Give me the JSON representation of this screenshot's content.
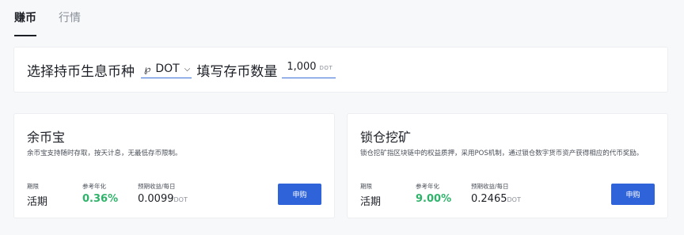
{
  "tabs": [
    {
      "label": "赚币",
      "active": true
    },
    {
      "label": "行情",
      "active": false
    }
  ],
  "selector": {
    "prefix": "选择持币生息币种",
    "coin": "DOT",
    "coin_icon": "polkadot-logo-icon",
    "middle": "填写存币数量",
    "amount": "1,000",
    "amount_unit": "DOT"
  },
  "cards": [
    {
      "title": "余币宝",
      "desc": "余币宝支持随时存取，按天计息，无最低存币限制。",
      "term_label": "期限",
      "term_value": "活期",
      "rate_label": "参考年化",
      "rate_value": "0.36%",
      "income_label": "预期收益/每日",
      "income_value": "0.0099",
      "income_unit": "DOT",
      "button": "申购"
    },
    {
      "title": "锁仓挖矿",
      "desc": "锁仓挖矿指区块链中的权益质押，采用POS机制，通过锁仓数字货币资产获得相应的代币奖励。",
      "term_label": "期限",
      "term_value": "活期",
      "rate_label": "参考年化",
      "rate_value": "9.00%",
      "income_label": "预期收益/每日",
      "income_value": "0.2465",
      "income_unit": "DOT",
      "button": "申购"
    }
  ],
  "colors": {
    "accent": "#2f63d9",
    "positive": "#2fb36a",
    "underline": "#3b6fd8"
  }
}
